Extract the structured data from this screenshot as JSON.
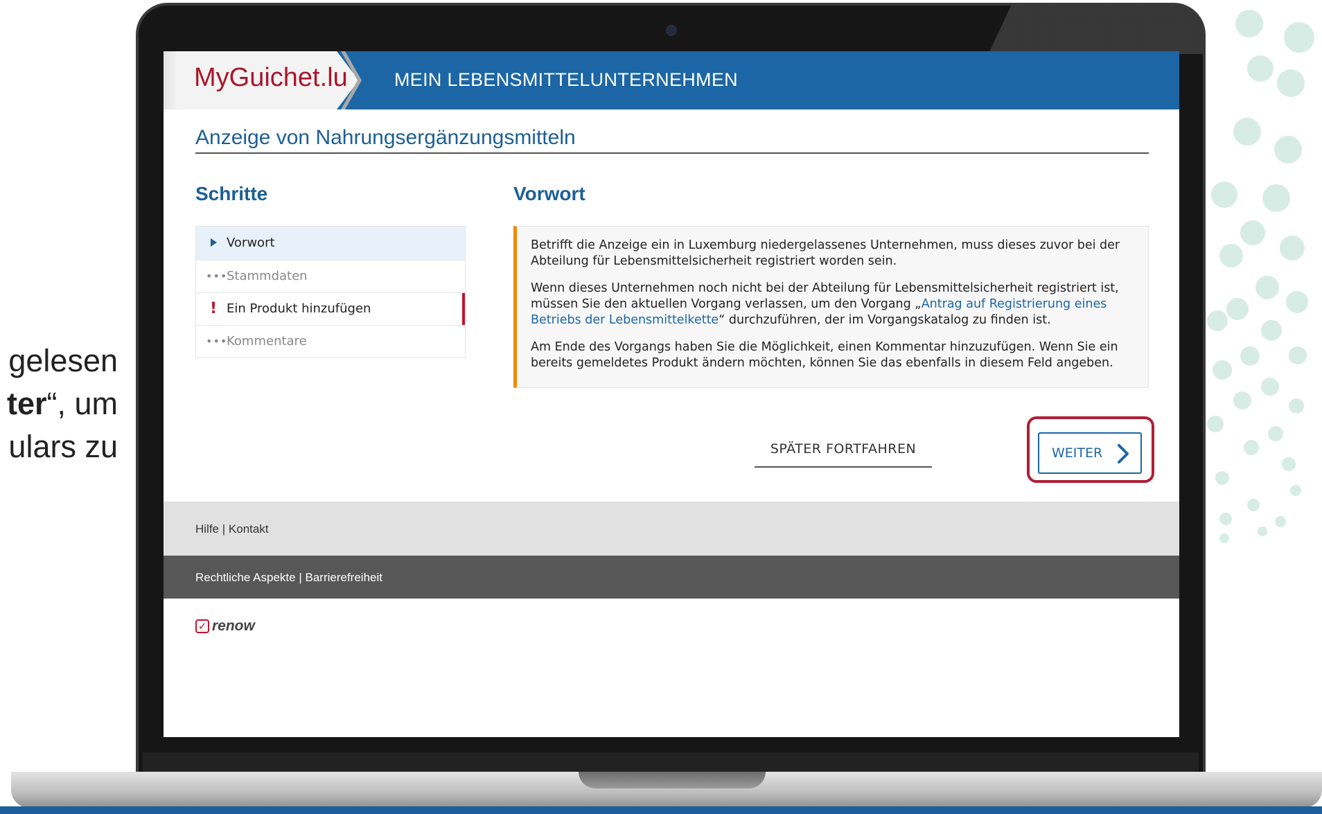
{
  "instruction": {
    "line1": "gelesen",
    "line2_bold": "ter",
    "line2_rest": "“, um",
    "line3": "ulars zu"
  },
  "header": {
    "logo_main": "MyGuichet",
    "logo_dot": ".",
    "logo_tld": "lu",
    "title": "MEIN LEBENSMITTELUNTERNEHMEN"
  },
  "page": {
    "title": "Anzeige von Nahrungsergänzungsmitteln"
  },
  "steps": {
    "heading": "Schritte",
    "items": [
      {
        "label": "Vorwort",
        "state": "active"
      },
      {
        "label": "Stammdaten",
        "state": "pending"
      },
      {
        "label": "Ein Produkt hinzufügen",
        "state": "error"
      },
      {
        "label": "Kommentare",
        "state": "pending"
      }
    ]
  },
  "content": {
    "heading": "Vorwort",
    "para1": "Betrifft die Anzeige ein in Luxemburg niedergelassenes Unternehmen, muss dieses zuvor bei der Abteilung für Lebensmittelsicherheit registriert worden sein.",
    "para2_before": "Wenn dieses Unternehmen noch nicht bei der Abteilung für Lebensmittelsicherheit registriert ist, müssen Sie den aktuellen Vorgang verlassen, um den Vorgang „",
    "para2_link": "Antrag auf Registrierung eines Betriebs der Lebensmittelkette",
    "para2_after": "“ durchzuführen, der im Vorgangskatalog zu finden ist.",
    "para3": "Am Ende des Vorgangs haben Sie die Möglichkeit, einen Kommentar hinzuzufügen. Wenn Sie ein bereits gemeldetes Produkt ändern möchten, können Sie das ebenfalls in diesem Feld angeben."
  },
  "buttons": {
    "later": "SPÄTER FORTFAHREN",
    "next": "WEITER"
  },
  "footer": {
    "help": "Hilfe",
    "contact": "Kontakt",
    "legal": "Rechtliche Aspekte",
    "accessibility": "Barrierefreiheit",
    "separator": "|",
    "brand": "renow"
  },
  "icons": {
    "step_active": "caret-right-icon",
    "step_pending": "ellipsis-icon",
    "step_error": "exclamation-icon",
    "next": "chevron-right-icon",
    "brand": "checkbox-icon"
  },
  "colors": {
    "brand_blue": "#1c66a6",
    "brand_red": "#a8172b",
    "warning_orange": "#f08a00",
    "highlight_red": "#b01d35"
  }
}
